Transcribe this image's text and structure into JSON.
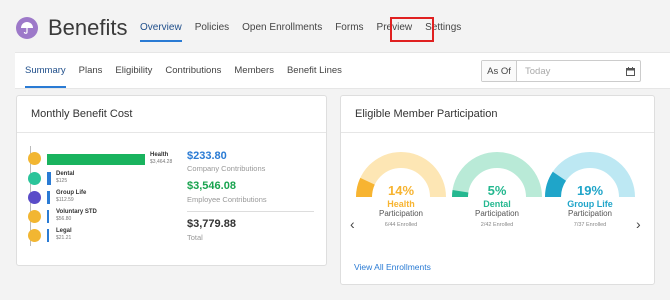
{
  "header": {
    "title": "Benefits",
    "nav": [
      "Overview",
      "Policies",
      "Open Enrollments",
      "Forms",
      "Preview",
      "Settings"
    ]
  },
  "subnav": {
    "tabs": [
      "Summary",
      "Plans",
      "Eligibility",
      "Contributions",
      "Members",
      "Benefit Lines"
    ],
    "as_of_label": "As Of",
    "as_of_placeholder": "Today"
  },
  "cost_card": {
    "title": "Monthly Benefit Cost",
    "items": [
      {
        "name": "Health",
        "amount": "$3,464.28",
        "value": 3464.28,
        "color": "#f2b632",
        "bar": "#19b35e"
      },
      {
        "name": "Dental",
        "amount": "$125",
        "value": 125,
        "color": "#2bc49a",
        "bar": "#2a7bd4"
      },
      {
        "name": "Group Life",
        "amount": "$112.59",
        "value": 112.59,
        "color": "#5a4cc8",
        "bar": "#2a7bd4"
      },
      {
        "name": "Voluntary STD",
        "amount": "$56.80",
        "value": 56.8,
        "color": "#f2b632",
        "bar": "#2a7bd4"
      },
      {
        "name": "Legal",
        "amount": "$21.21",
        "value": 21.21,
        "color": "#f2b632",
        "bar": "#2a7bd4"
      }
    ],
    "company_value": "$233.80",
    "company_label": "Company Contributions",
    "employee_value": "$3,546.08",
    "employee_label": "Employee Contributions",
    "total_value": "$3,779.88",
    "total_label": "Total"
  },
  "participation_card": {
    "title": "Eligible Member Participation",
    "gauges": [
      {
        "pct": "14%",
        "value": 14,
        "name": "Health",
        "label": "Participation",
        "sub": "6/44 Enrolled",
        "color": "#f7b431",
        "track": "#fde6b4"
      },
      {
        "pct": "5%",
        "value": 5,
        "name": "Dental",
        "label": "Participation",
        "sub": "2/42 Enrolled",
        "color": "#25b890",
        "track": "#b9ead7"
      },
      {
        "pct": "19%",
        "value": 19,
        "name": "Group Life",
        "label": "Participation",
        "sub": "7/37 Enrolled",
        "color": "#1fa5c9",
        "track": "#bde8f3"
      }
    ],
    "view_all": "View All Enrollments"
  }
}
